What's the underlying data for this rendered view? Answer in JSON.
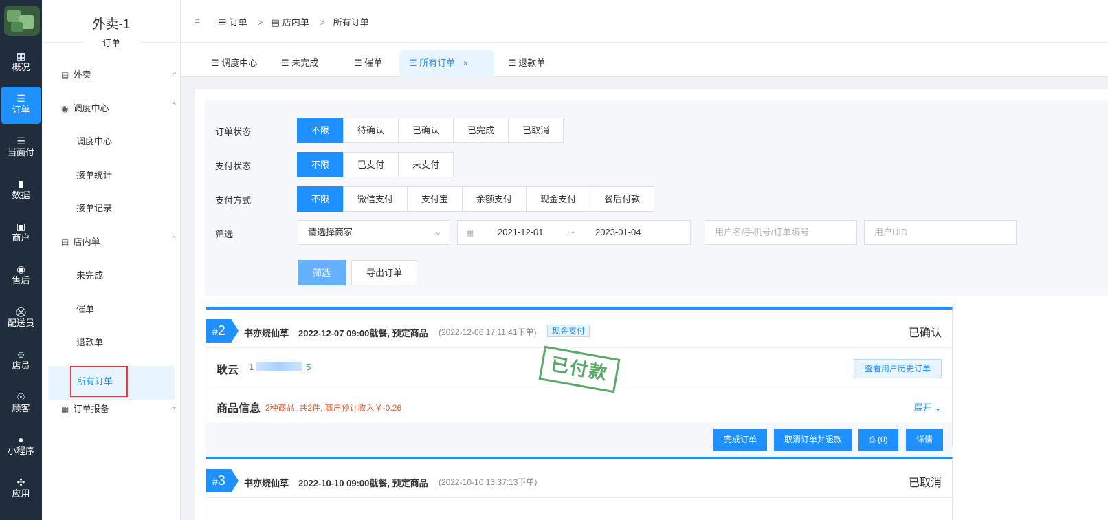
{
  "rail": {
    "items": [
      {
        "label": "概况",
        "icon": "dashboard-icon"
      },
      {
        "label": "订单",
        "icon": "list-icon",
        "active": true
      },
      {
        "label": "当面付",
        "icon": "list-icon"
      },
      {
        "label": "数据",
        "icon": "bar-chart-icon"
      },
      {
        "label": "商户",
        "icon": "store-icon"
      },
      {
        "label": "售后",
        "icon": "headset-icon"
      },
      {
        "label": "配送员",
        "icon": "delivery-icon"
      },
      {
        "label": "店员",
        "icon": "staff-icon"
      },
      {
        "label": "顾客",
        "icon": "customer-icon"
      },
      {
        "label": "小程序",
        "icon": "wechat-icon"
      },
      {
        "label": "应用",
        "icon": "apps-icon"
      }
    ]
  },
  "side": {
    "shop_name": "外卖-1",
    "section": "订单",
    "groups": [
      {
        "label": "外卖"
      },
      {
        "label": "调度中心"
      },
      {
        "label": "店内单"
      },
      {
        "label": "订单报备"
      }
    ],
    "sub_dispatch": [
      "调度中心",
      "接单统计",
      "接单记录"
    ],
    "sub_dinein": [
      "未完成",
      "催单",
      "退款单",
      "所有订单"
    ]
  },
  "breadcrumb": [
    "订单",
    "店内单",
    "所有订单"
  ],
  "tabs": [
    {
      "label": "调度中心"
    },
    {
      "label": "未完成"
    },
    {
      "label": "催单"
    },
    {
      "label": "所有订单",
      "active": true
    },
    {
      "label": "退款单"
    }
  ],
  "filters": {
    "order_status_label": "订单状态",
    "order_status": [
      "不限",
      "待确认",
      "已确认",
      "已完成",
      "已取消"
    ],
    "pay_status_label": "支付状态",
    "pay_status": [
      "不限",
      "已支付",
      "未支付"
    ],
    "pay_method_label": "支付方式",
    "pay_method": [
      "不限",
      "微信支付",
      "支付宝",
      "余额支付",
      "现金支付",
      "餐后付款"
    ],
    "filter_label": "筛选",
    "merchant_placeholder": "请选择商家",
    "date_start": "2021-12-01",
    "date_sep": "~",
    "date_end": "2023-01-04",
    "keyword_placeholder": "用户名/手机号/订单编号",
    "uid_placeholder": "用户UID",
    "filter_button": "筛选",
    "export_button": "导出订单"
  },
  "orders": [
    {
      "num_prefix": "#",
      "num": "2",
      "shop": "书亦烧仙草",
      "time": "2022-12-07 09:00就餐, 预定商品",
      "created": "(2022-12-06 17:11:41下单)",
      "pay_tag": "现金支付",
      "status": "已确认",
      "customer": "耿云",
      "phone_prefix": "1",
      "phone_suffix": "5",
      "history_button": "查看用户历史订单",
      "stamp": "已付款",
      "goods_title": "商品信息",
      "goods_info": "2种商品, 共2件, 商户预计收入￥-0.26",
      "expand": "展开",
      "actions": [
        "完成订单",
        "取消订单并退款",
        "(0)",
        "详情"
      ]
    },
    {
      "num_prefix": "#",
      "num": "3",
      "shop": "书亦烧仙草",
      "time": "2022-10-10 09:00就餐, 预定商品",
      "created": "(2022-10-10 13:37:13下单)",
      "status": "已取消"
    }
  ],
  "colors": {
    "accent": "#1e90ff",
    "rail": "#1f2d3d",
    "warn": "#e85a2c",
    "stamp": "#3d9a4e"
  }
}
